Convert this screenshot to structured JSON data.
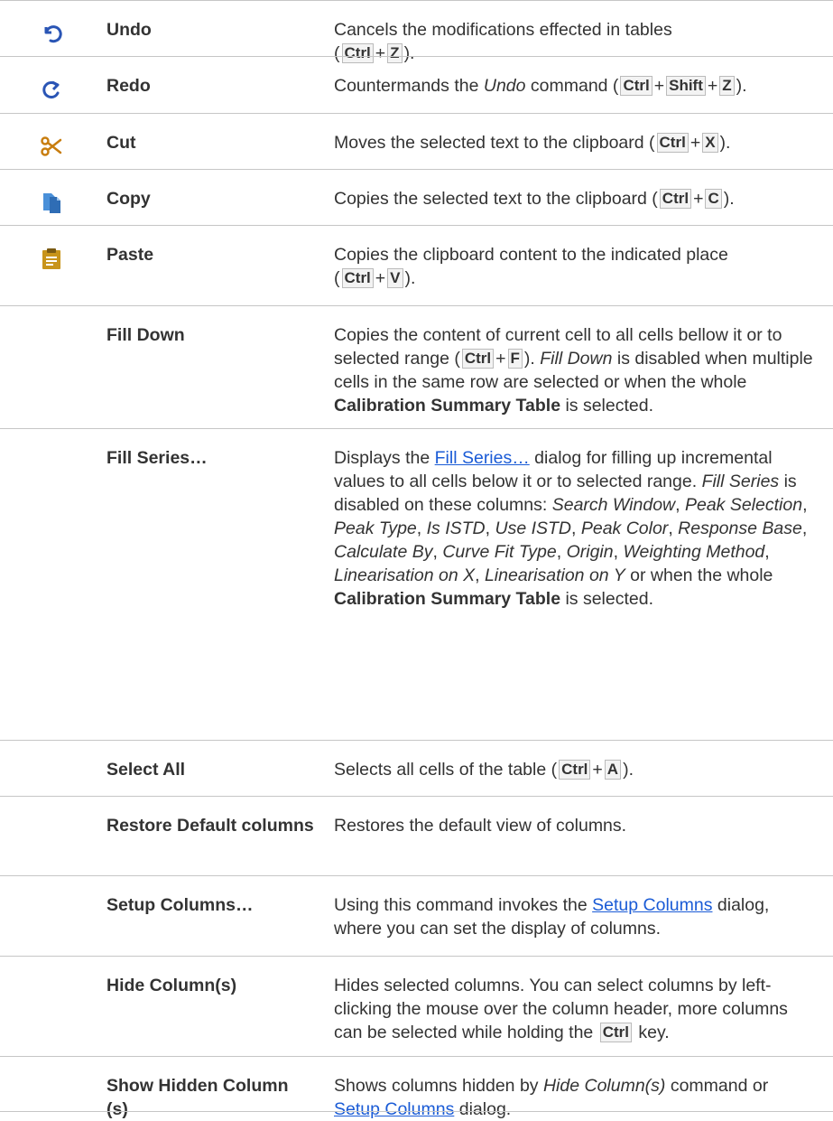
{
  "rows": [
    {
      "icon": "undo-icon",
      "command": "Undo",
      "desc": [
        {
          "t": "Cancels the modifications effected in tables"
        },
        {
          "br": 1
        },
        {
          "t": "("
        },
        {
          "k": "Ctrl"
        },
        {
          "t": "+"
        },
        {
          "k": "Z"
        },
        {
          "t": ")."
        }
      ]
    },
    {
      "icon": "redo-icon",
      "command": "Redo",
      "desc": [
        {
          "t": "Countermands the "
        },
        {
          "i": "Undo"
        },
        {
          "t": " command ("
        },
        {
          "k": "Ctrl"
        },
        {
          "t": "+"
        },
        {
          "k": "Shift"
        },
        {
          "t": "+"
        },
        {
          "k": "Z"
        },
        {
          "t": ")."
        }
      ]
    },
    {
      "icon": "scissors-icon",
      "command": "Cut",
      "desc": [
        {
          "t": "Moves the selected text to the clipboard ("
        },
        {
          "k": "Ctrl"
        },
        {
          "t": "+"
        },
        {
          "k": "X"
        },
        {
          "t": ")."
        }
      ]
    },
    {
      "icon": "copy-icon",
      "command": "Copy",
      "desc": [
        {
          "t": "Copies the selected text to the clipboard ("
        },
        {
          "k": "Ctrl"
        },
        {
          "t": "+"
        },
        {
          "k": "C"
        },
        {
          "t": ")."
        }
      ]
    },
    {
      "icon": "paste-icon",
      "command": "Paste",
      "desc": [
        {
          "t": "Copies the clipboard content to the indicated place"
        },
        {
          "br": 1
        },
        {
          "t": "("
        },
        {
          "k": "Ctrl"
        },
        {
          "t": "+"
        },
        {
          "k": "V"
        },
        {
          "t": ")."
        }
      ]
    },
    {
      "icon": "",
      "command": "Fill Down",
      "desc": [
        {
          "t": "Copies the content of current cell to all cells bellow it or to selected range ("
        },
        {
          "k": "Ctrl"
        },
        {
          "t": "+"
        },
        {
          "k": "F"
        },
        {
          "t": "). "
        },
        {
          "i": "Fill Down"
        },
        {
          "t": " is disabled when multiple cells in the same row are selected or when the whole "
        },
        {
          "b": "Calibration Summary Table"
        },
        {
          "t": " is selected."
        }
      ]
    },
    {
      "icon": "",
      "command": "Fill Series…",
      "desc": [
        {
          "t": "Displays the "
        },
        {
          "a": "Fill Series…"
        },
        {
          "t": " dialog for filling up incremental values to all cells below it or to selected range. "
        },
        {
          "i": "Fill Series"
        },
        {
          "t": " is disabled on these columns: "
        },
        {
          "i": "Search Window"
        },
        {
          "t": ", "
        },
        {
          "i": "Peak Selection"
        },
        {
          "t": ", "
        },
        {
          "i": "Peak Type"
        },
        {
          "t": ", "
        },
        {
          "i": "Is ISTD"
        },
        {
          "t": ", "
        },
        {
          "i": "Use ISTD"
        },
        {
          "t": ", "
        },
        {
          "i": "Peak Color"
        },
        {
          "t": ", "
        },
        {
          "i": "Response Base"
        },
        {
          "t": ", "
        },
        {
          "i": "Calculate By"
        },
        {
          "t": ", "
        },
        {
          "i": "Curve Fit Type"
        },
        {
          "t": ", "
        },
        {
          "i": "Origin"
        },
        {
          "t": ", "
        },
        {
          "i": "Weighting Method"
        },
        {
          "t": ", "
        },
        {
          "i": "Linearisation on X"
        },
        {
          "t": ", "
        },
        {
          "i": "Linearisation on Y"
        },
        {
          "t": " or when the whole "
        },
        {
          "b": "Calibration Summary Table"
        },
        {
          "t": " is selected."
        }
      ]
    },
    {
      "icon": "",
      "command": "Select All",
      "desc": [
        {
          "t": "Selects all cells of the table ("
        },
        {
          "k": "Ctrl"
        },
        {
          "t": "+"
        },
        {
          "k": "A"
        },
        {
          "t": ")."
        }
      ]
    },
    {
      "icon": "",
      "command": "Restore Default columns",
      "desc": [
        {
          "t": "Restores the default view of columns."
        }
      ]
    },
    {
      "icon": "",
      "command": "Setup Columns…",
      "desc": [
        {
          "t": "Using this command invokes the "
        },
        {
          "a": "Setup Columns"
        },
        {
          "t": " dialog, where you can set the display of columns."
        }
      ]
    },
    {
      "icon": "",
      "command": "Hide Column(s)",
      "desc": [
        {
          "t": "Hides selected columns. You can select columns by left-clicking the mouse over the column header, more columns can be selected while holding the "
        },
        {
          "k": "Ctrl"
        },
        {
          "t": " key."
        }
      ]
    },
    {
      "icon": "",
      "command": "Show Hidden Column (s)",
      "desc": [
        {
          "t": "Shows columns hidden by "
        },
        {
          "i": "Hide Column(s)"
        },
        {
          "t": " command or "
        },
        {
          "a": "Setup Columns"
        },
        {
          "t": " dialog."
        }
      ]
    }
  ],
  "colors": {
    "link": "#1a5bd6",
    "border": "#c6c6c6",
    "undo": "#2a55b5",
    "redo": "#2a55b5",
    "scissors": "#c87d0e",
    "copy": "#4a90d9",
    "paste": "#c8941a"
  }
}
